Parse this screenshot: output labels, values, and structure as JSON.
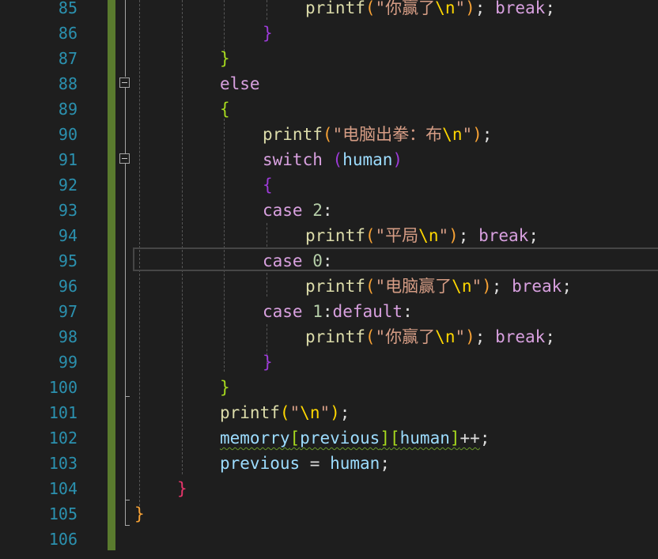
{
  "editor": {
    "lines": [
      {
        "number": "85"
      },
      {
        "number": "86"
      },
      {
        "number": "87"
      },
      {
        "number": "88"
      },
      {
        "number": "89"
      },
      {
        "number": "90"
      },
      {
        "number": "91"
      },
      {
        "number": "92"
      },
      {
        "number": "93"
      },
      {
        "number": "94"
      },
      {
        "number": "95"
      },
      {
        "number": "96"
      },
      {
        "number": "97"
      },
      {
        "number": "98"
      },
      {
        "number": "99"
      },
      {
        "number": "100"
      },
      {
        "number": "101"
      },
      {
        "number": "102"
      },
      {
        "number": "103"
      },
      {
        "number": "104"
      },
      {
        "number": "105"
      },
      {
        "number": "106"
      }
    ],
    "current_line": "95",
    "tokens": {
      "printf": "printf",
      "break": "break",
      "else": "else",
      "switch": "switch",
      "case": "case",
      "default": "default",
      "human": "human",
      "memorry": "memorry",
      "previous": "previous",
      "open_paren": "(",
      "close_paren": ")",
      "open_brace": "{",
      "close_brace": "}",
      "open_bracket": "[",
      "close_bracket": "]",
      "quote": "\"",
      "newline_escape": "\\n",
      "semicolon": ";",
      "colon": ":",
      "equals": " = ",
      "increment": "++",
      "num_0": "0",
      "num_1": "1",
      "num_2": "2",
      "str_you_win": "你赢了",
      "str_computer_cloth": "电脑出拳：布",
      "str_draw": "平局",
      "str_computer_wins": "电脑赢了"
    }
  },
  "colors": {
    "background": "#1e1e1e",
    "line_number": "#2b91af",
    "keyword": "#d8a0df",
    "function": "#dcdcaa",
    "string": "#d69d85",
    "variable": "#9cdcfe",
    "change_bar": "#5a7b2e"
  }
}
